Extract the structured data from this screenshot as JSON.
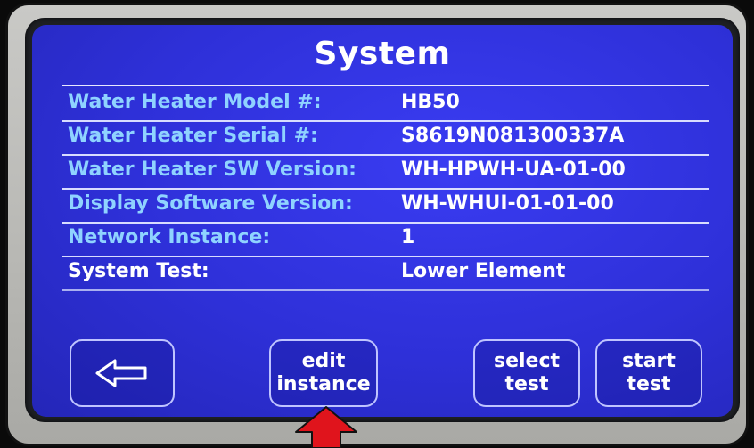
{
  "screen": {
    "title": "System"
  },
  "rows": [
    {
      "label": "Water Heater Model #:",
      "value": "HB50"
    },
    {
      "label": "Water Heater Serial #:",
      "value": "S8619N081300337A"
    },
    {
      "label": "Water Heater SW Version:",
      "value": "WH-HPWH-UA-01-00"
    },
    {
      "label": "Display Software Version:",
      "value": "WH-WHUI-01-01-00"
    },
    {
      "label": "Network Instance:",
      "value": "1"
    },
    {
      "label": "System Test:",
      "value": "Lower Element"
    }
  ],
  "buttons": {
    "back_icon": "left-arrow-icon",
    "edit_line1": "edit",
    "edit_line2": "instance",
    "select_line1": "select",
    "select_line2": "test",
    "start_line1": "start",
    "start_line2": "test"
  },
  "annotation": {
    "pointer_icon": "red-up-arrow-icon"
  },
  "colors": {
    "screen_bg": "#2e30d8",
    "label_text": "#8fd3ff",
    "value_text": "#ffffff",
    "pointer": "#e0141c"
  }
}
